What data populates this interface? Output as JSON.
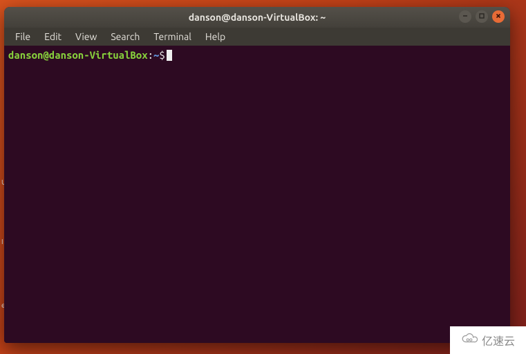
{
  "window": {
    "title": "danson@danson-VirtualBox: ~"
  },
  "menu": {
    "items": [
      "File",
      "Edit",
      "View",
      "Search",
      "Terminal",
      "Help"
    ]
  },
  "prompt": {
    "user_host": "danson@danson-VirtualBox",
    "separator": ":",
    "path": "~",
    "symbol": "$"
  },
  "dock": {
    "labels": [
      "U",
      "I",
      "e"
    ]
  },
  "watermark": {
    "text": "亿速云"
  }
}
